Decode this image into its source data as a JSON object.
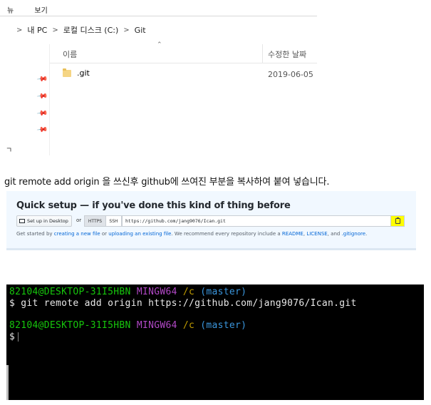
{
  "explorer": {
    "menu_fragment": [
      "뉴",
      "보기"
    ],
    "breadcrumb": [
      "내 PC",
      "로컬 디스크 (C:)",
      "Git"
    ],
    "columns": {
      "name": "이름",
      "date": "수정한 날짜"
    },
    "rows": [
      {
        "name": ".git",
        "date": "2019-06-05 "
      }
    ],
    "left_fragment": "ㄱ"
  },
  "instruction": "git remote add origin 을 쓰신후 github에 쓰여진 부분을 복사하여 붙여 넣습니다.",
  "github": {
    "title": "Quick setup — if you've done this kind of thing before",
    "desktop_button": "Set up in Desktop",
    "or_text": "or",
    "https_tab": "HTTPS",
    "ssh_tab": "SSH",
    "clone_url": "https://github.com/jang9076/Ican.git",
    "hint": {
      "p1": "Get started by ",
      "link1": "creating a new file",
      "p2": " or ",
      "link2": "uploading an existing file",
      "p3": ". We recommend every repository include a ",
      "link3": "README",
      "p4": ", ",
      "link4": "LICENSE",
      "p5": ", and ",
      "link5": ".gitignore",
      "p6": "."
    }
  },
  "terminal": {
    "user_host": "82104@DESKTOP-31I5HBN",
    "system": "MINGW64",
    "path": "/c",
    "branch": "(master)",
    "prompt": "$",
    "command": "git remote add origin https://github.com/jang9076/Ican.git",
    "colors": {
      "user_host": "#16c60c",
      "system": "#b148c6",
      "path": "#c19c00",
      "branch": "#3a96dd"
    }
  }
}
